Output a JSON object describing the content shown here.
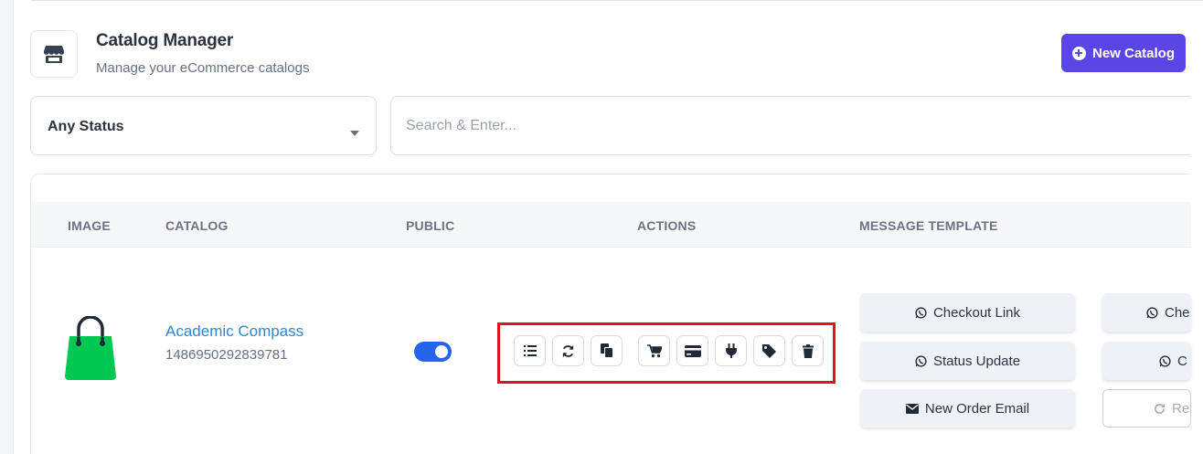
{
  "header": {
    "title": "Catalog Manager",
    "subtitle": "Manage your eCommerce catalogs",
    "new_button": "New Catalog"
  },
  "filters": {
    "status_value": "Any Status",
    "search_placeholder": "Search & Enter..."
  },
  "table": {
    "columns": [
      "IMAGE",
      "CATALOG",
      "PUBLIC",
      "ACTIONS",
      "MESSAGE TEMPLATE"
    ],
    "rows": [
      {
        "name": "Academic Compass",
        "id": "1486950292839781",
        "public": true,
        "templates": [
          "Checkout Link",
          "Status Update",
          "New Order Email"
        ],
        "templates_col2": [
          "Che",
          "C",
          "Re"
        ]
      }
    ]
  },
  "icons": {
    "header": "store-icon",
    "actions": [
      "list-icon",
      "sync-icon",
      "copy-icon",
      "cart-icon",
      "credit-card-icon",
      "plug-icon",
      "tag-icon",
      "trash-icon"
    ]
  },
  "colors": {
    "primary": "#5a46e6",
    "link": "#2f86d6",
    "toggle": "#2563eb",
    "highlight": "#e0141b",
    "bag": "#00c853"
  }
}
